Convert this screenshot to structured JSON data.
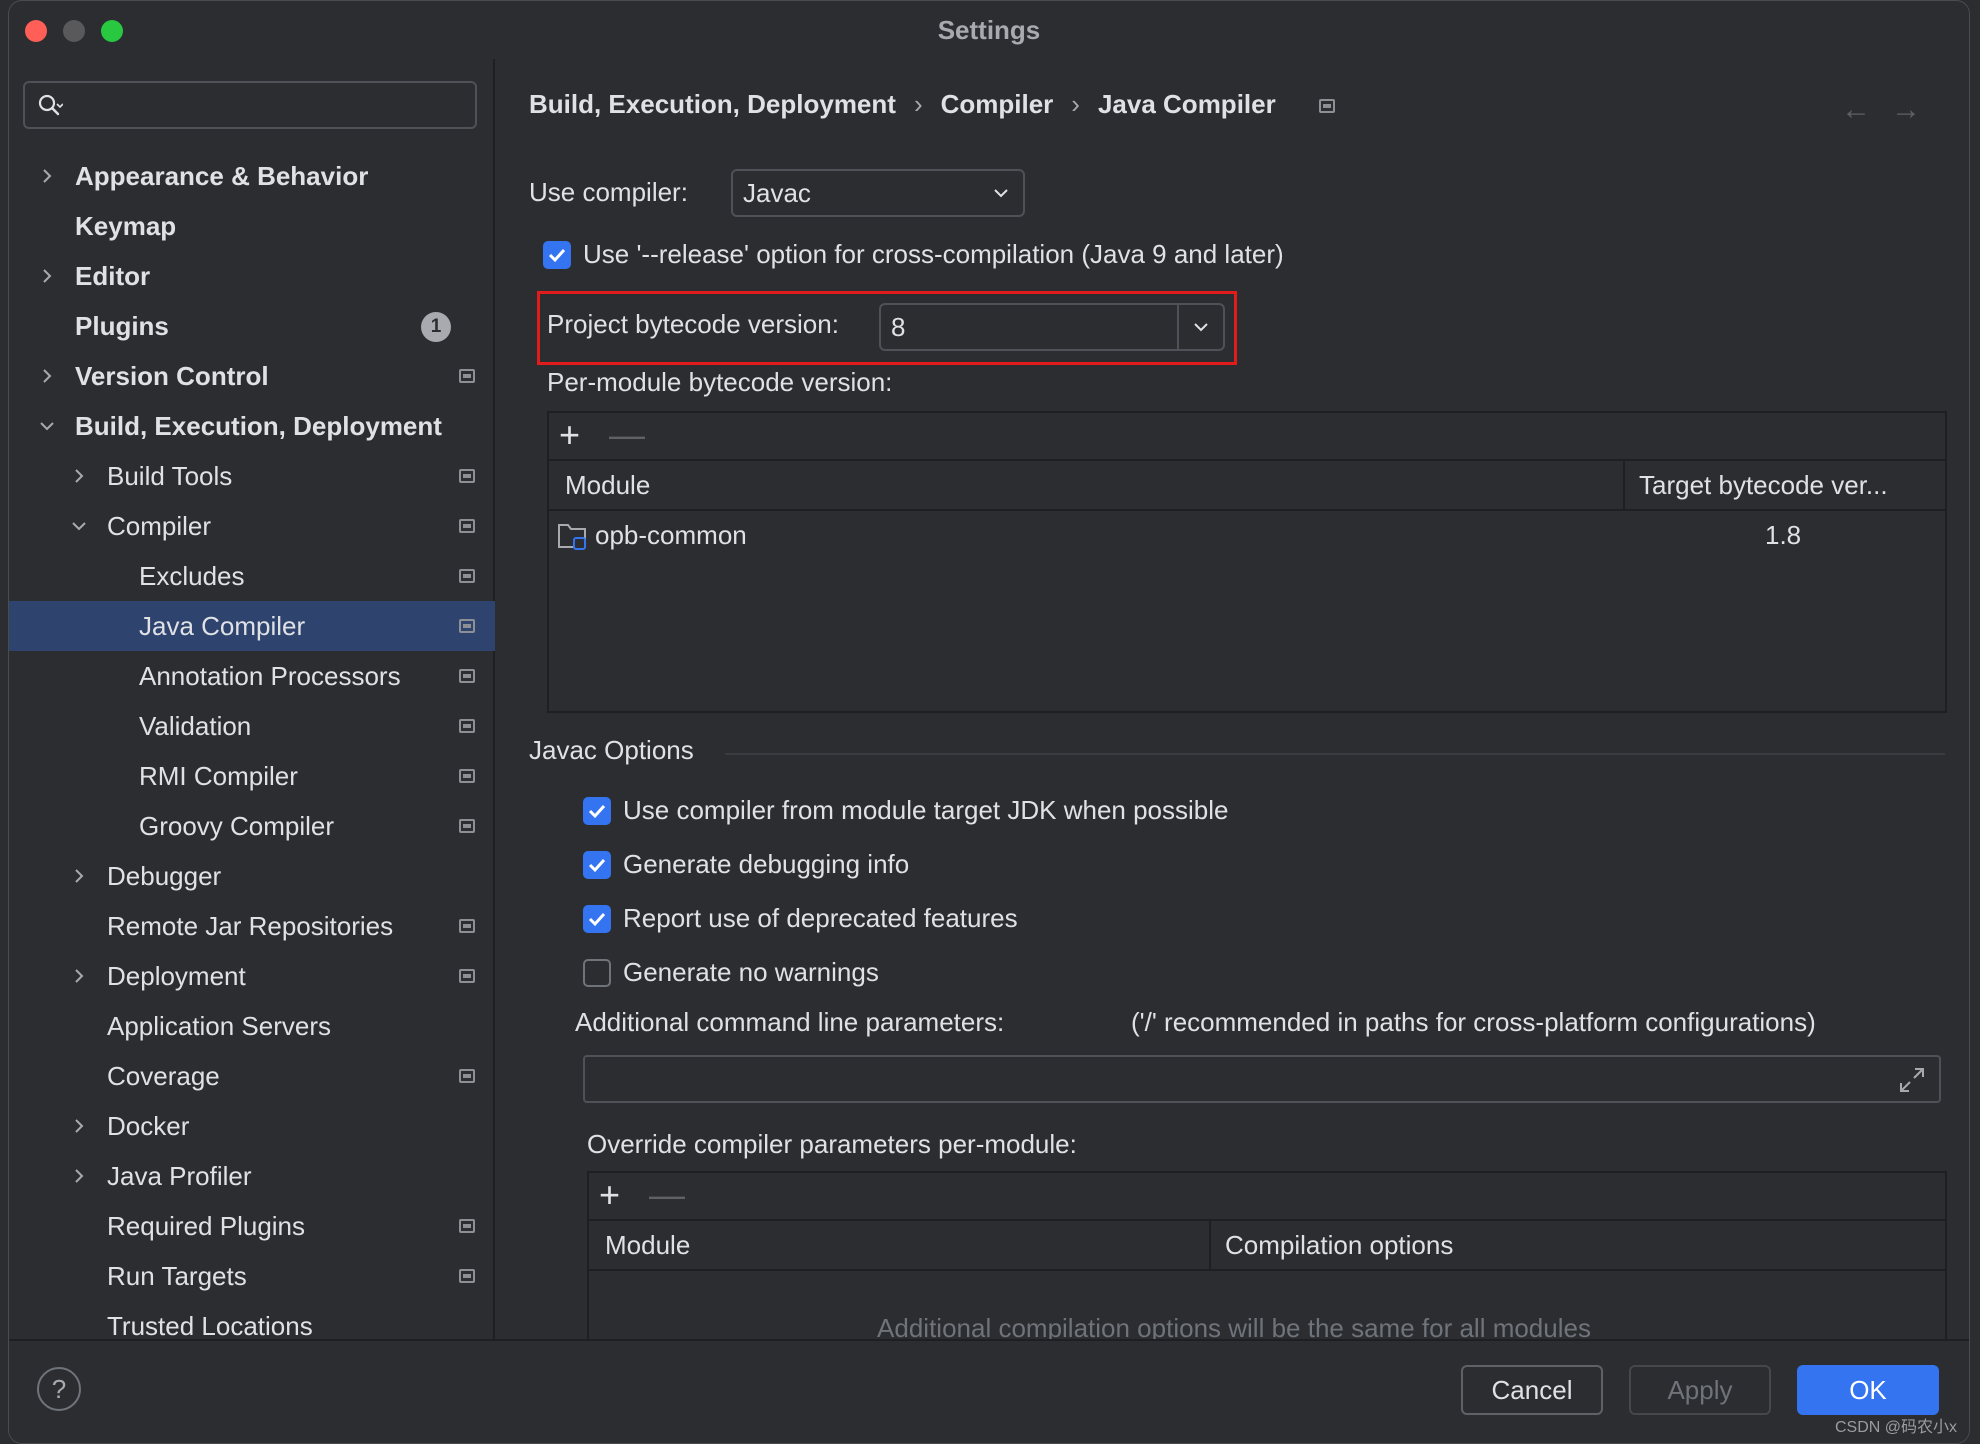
{
  "window": {
    "title": "Settings"
  },
  "sidebar": {
    "search_placeholder": "",
    "items": [
      {
        "label": "Appearance & Behavior",
        "level": 0,
        "bold": true,
        "chevron": "right",
        "proj": false
      },
      {
        "label": "Keymap",
        "level": 0,
        "bold": true,
        "chevron": "none",
        "proj": false
      },
      {
        "label": "Editor",
        "level": 0,
        "bold": true,
        "chevron": "right",
        "proj": false
      },
      {
        "label": "Plugins",
        "level": 0,
        "bold": true,
        "chevron": "none",
        "proj": false,
        "badge": "1"
      },
      {
        "label": "Version Control",
        "level": 0,
        "bold": true,
        "chevron": "right",
        "proj": true
      },
      {
        "label": "Build, Execution, Deployment",
        "level": 0,
        "bold": true,
        "chevron": "down",
        "proj": false
      },
      {
        "label": "Build Tools",
        "level": 1,
        "bold": false,
        "chevron": "right",
        "proj": true
      },
      {
        "label": "Compiler",
        "level": 1,
        "bold": false,
        "chevron": "down",
        "proj": true
      },
      {
        "label": "Excludes",
        "level": 2,
        "bold": false,
        "chevron": "none",
        "proj": true
      },
      {
        "label": "Java Compiler",
        "level": 2,
        "bold": false,
        "chevron": "none",
        "proj": true,
        "selected": true
      },
      {
        "label": "Annotation Processors",
        "level": 2,
        "bold": false,
        "chevron": "none",
        "proj": true
      },
      {
        "label": "Validation",
        "level": 2,
        "bold": false,
        "chevron": "none",
        "proj": true
      },
      {
        "label": "RMI Compiler",
        "level": 2,
        "bold": false,
        "chevron": "none",
        "proj": true
      },
      {
        "label": "Groovy Compiler",
        "level": 2,
        "bold": false,
        "chevron": "none",
        "proj": true
      },
      {
        "label": "Debugger",
        "level": 1,
        "bold": false,
        "chevron": "right",
        "proj": false
      },
      {
        "label": "Remote Jar Repositories",
        "level": 1,
        "bold": false,
        "chevron": "none",
        "proj": true
      },
      {
        "label": "Deployment",
        "level": 1,
        "bold": false,
        "chevron": "right",
        "proj": true
      },
      {
        "label": "Application Servers",
        "level": 1,
        "bold": false,
        "chevron": "none",
        "proj": false
      },
      {
        "label": "Coverage",
        "level": 1,
        "bold": false,
        "chevron": "none",
        "proj": true
      },
      {
        "label": "Docker",
        "level": 1,
        "bold": false,
        "chevron": "right",
        "proj": false
      },
      {
        "label": "Java Profiler",
        "level": 1,
        "bold": false,
        "chevron": "right",
        "proj": false
      },
      {
        "label": "Required Plugins",
        "level": 1,
        "bold": false,
        "chevron": "none",
        "proj": true
      },
      {
        "label": "Run Targets",
        "level": 1,
        "bold": false,
        "chevron": "none",
        "proj": true
      },
      {
        "label": "Trusted Locations",
        "level": 1,
        "bold": false,
        "chevron": "none",
        "proj": false
      }
    ]
  },
  "breadcrumb": [
    "Build, Execution, Deployment",
    "Compiler",
    "Java Compiler"
  ],
  "breadcrumb_sep": "›",
  "nav": {
    "back": "←",
    "forward": "→"
  },
  "compiler": {
    "use_compiler_label": "Use compiler:",
    "use_compiler_value": "Javac",
    "release_option_label": "Use '--release' option for cross-compilation (Java 9 and later)",
    "release_option_checked": true,
    "project_bytecode_label": "Project bytecode version:",
    "project_bytecode_value": "8",
    "per_module_label": "Per-module bytecode version:",
    "per_module_table": {
      "plus": "+",
      "minus": "—",
      "columns": [
        "Module",
        "Target bytecode ver..."
      ],
      "rows": [
        {
          "module": "opb-common",
          "target": "1.8"
        }
      ]
    }
  },
  "javac": {
    "section_title": "Javac Options",
    "options": [
      {
        "label": "Use compiler from module target JDK when possible",
        "checked": true
      },
      {
        "label": "Generate debugging info",
        "checked": true
      },
      {
        "label": "Report use of deprecated features",
        "checked": true
      },
      {
        "label": "Generate no warnings",
        "checked": false
      }
    ],
    "additional_params_label": "Additional command line parameters:",
    "additional_params_hint": "('/' recommended in paths for cross-platform configurations)",
    "additional_params_value": "",
    "override_label": "Override compiler parameters per-module:",
    "override_table": {
      "plus": "+",
      "minus": "—",
      "columns": [
        "Module",
        "Compilation options"
      ],
      "empty_text": "Additional compilation options will be the same for all modules"
    }
  },
  "footer": {
    "help": "?",
    "cancel": "Cancel",
    "apply": "Apply",
    "ok": "OK",
    "watermark": "CSDN @码农小x"
  },
  "colors": {
    "accent": "#3574f0",
    "selection": "#2e436e",
    "highlight_box": "#e21b1b",
    "background": "#2b2d30"
  }
}
